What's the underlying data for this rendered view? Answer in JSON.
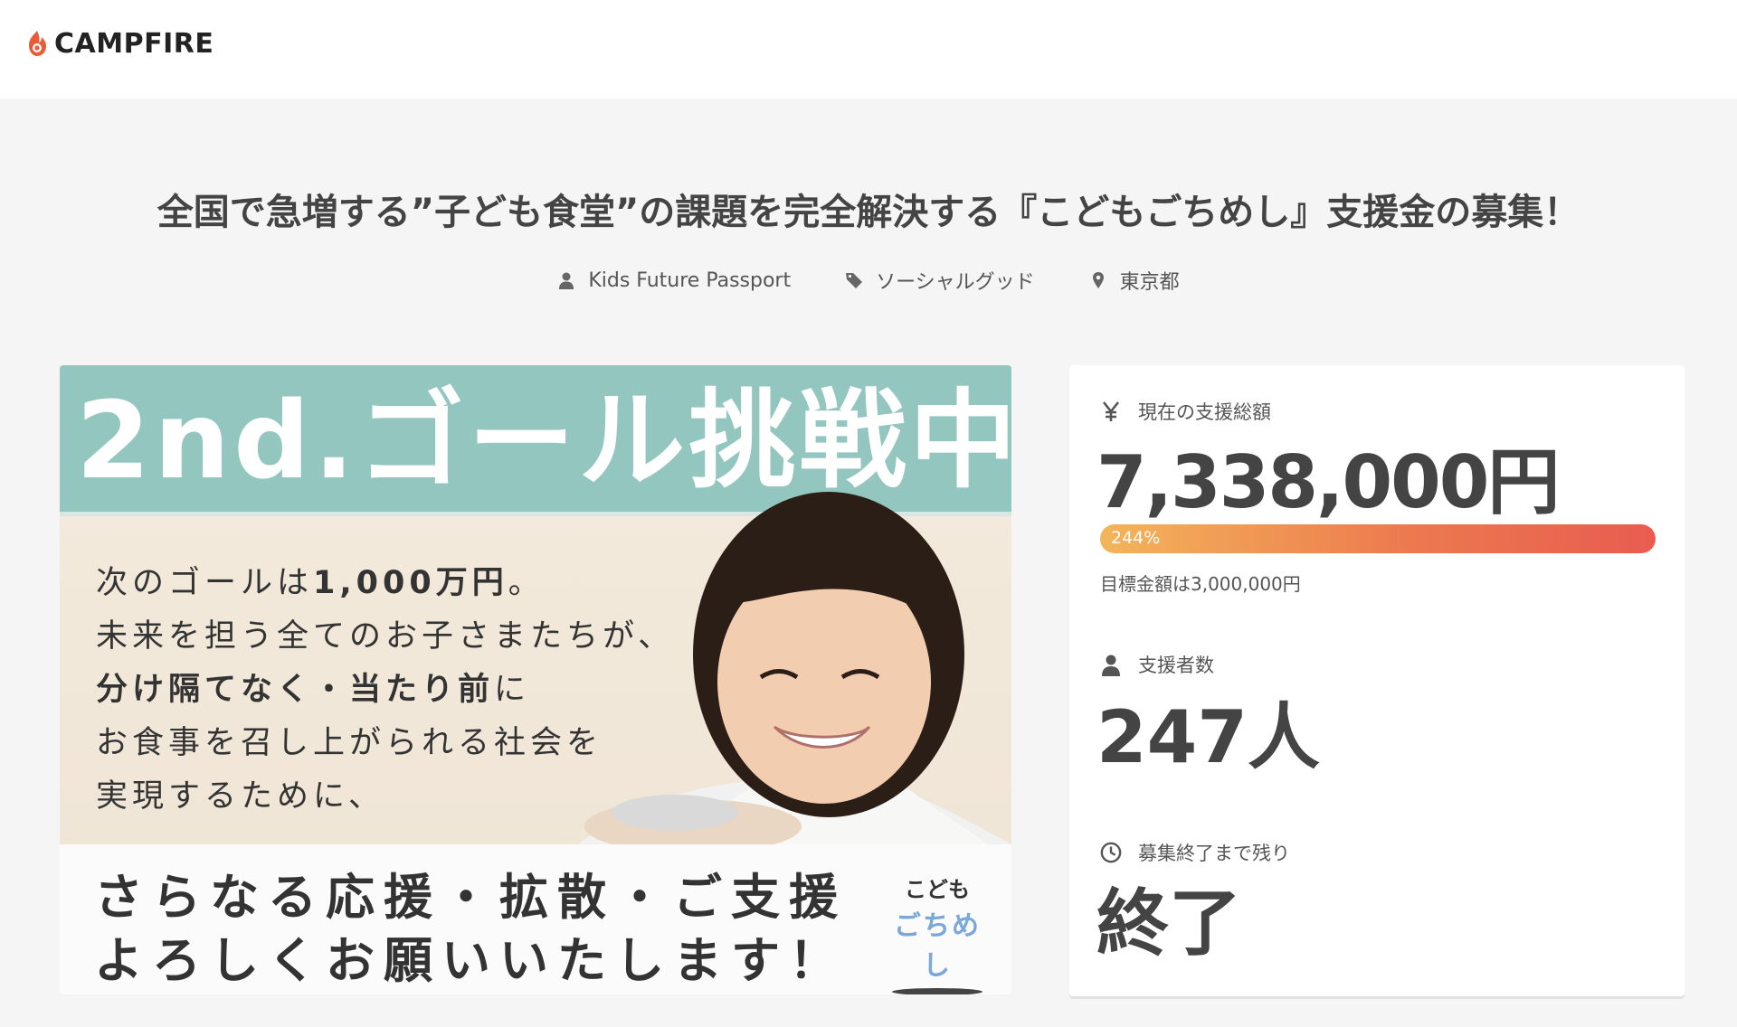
{
  "header": {
    "logo_text": "CAMPFIRE",
    "logo_icon": "flame-icon",
    "brand_color": "#e85c3a"
  },
  "project": {
    "title": "全国で急増する”子ども食堂”の課題を完全解決する『こどもごちめし』支援金の募集！",
    "owner": "Kids Future Passport",
    "category": "ソーシャルグッド",
    "location": "東京都"
  },
  "hero": {
    "banner": "2nd.ゴール挑戦中！",
    "line1_pre": "次のゴールは",
    "line1_bold": "1,000万円",
    "line1_post": "。",
    "line2": "未来を担う全てのお子さまたちが、",
    "line3_bold": "分け隔てなく・当たり前",
    "line3_post": "に",
    "line4": "お食事を召し上がられる社会を",
    "line5": "実現するために、",
    "bottom1": "さらなる応援・拡散・ご支援",
    "bottom2": "よろしくお願いいたします！",
    "logo_l1": "こども",
    "logo_l2": "ごちめし"
  },
  "stats": {
    "amount_label": "現在の支援総額",
    "amount": "7,338,000円",
    "progress_label": "244%",
    "progress_percent": 244,
    "goal": "目標金額は3,000,000円",
    "backers_label": "支援者数",
    "backers": "247人",
    "remaining_label": "募集終了まで残り",
    "remaining": "終了"
  },
  "colors": {
    "progress_start": "#f3b55a",
    "progress_end": "#e85c50",
    "banner": "#94c6c0",
    "text_dark": "#444444"
  }
}
